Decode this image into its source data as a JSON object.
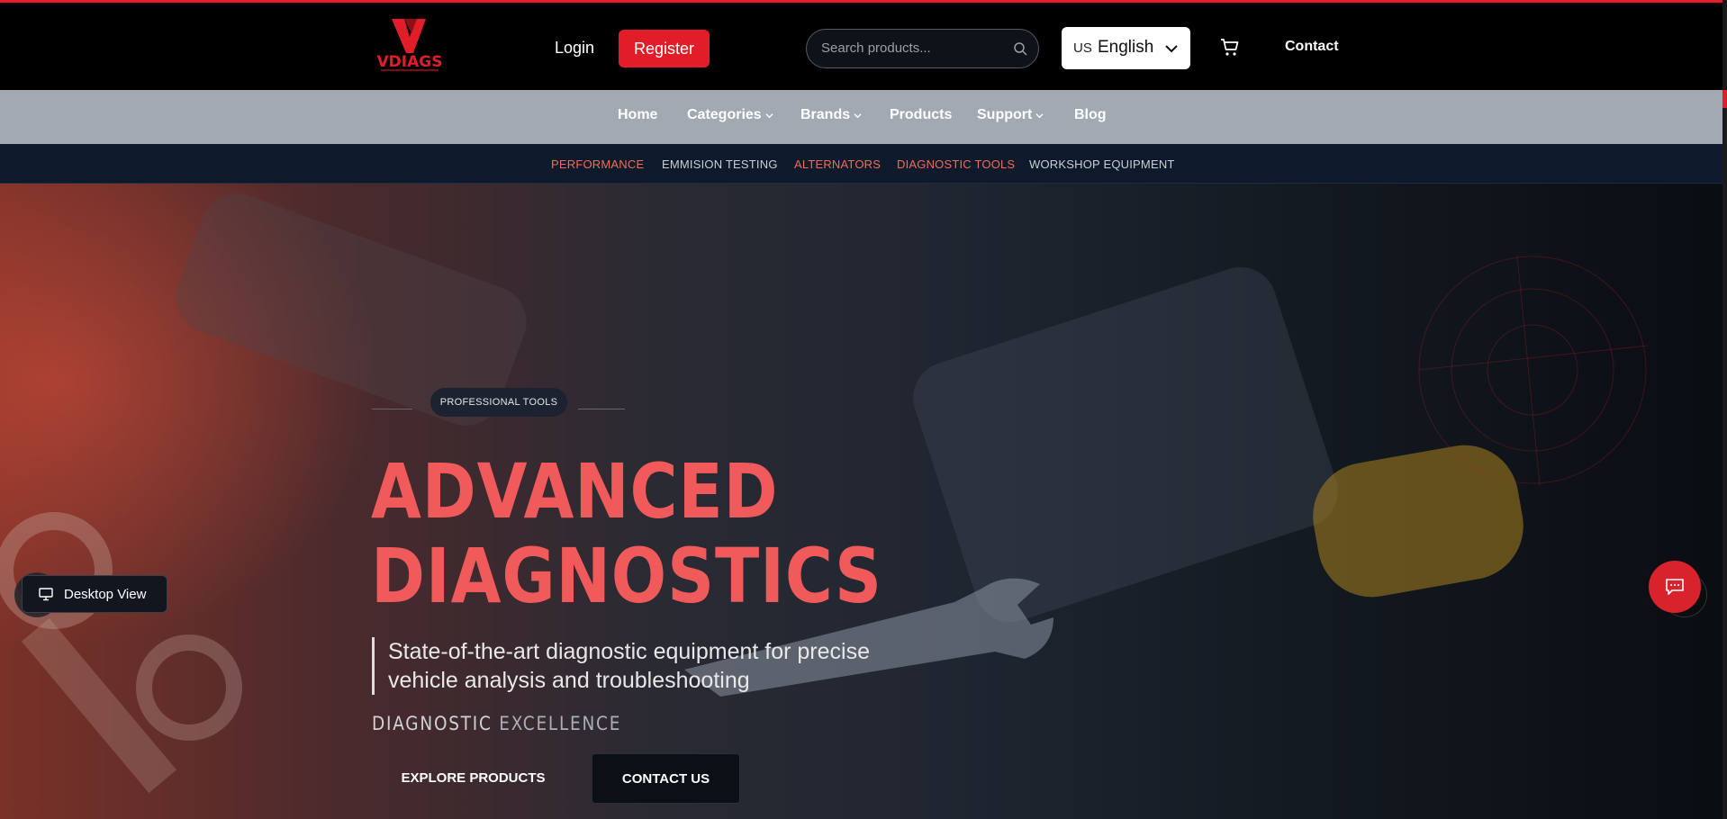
{
  "header": {
    "logo_text": "VDIAGS",
    "login_label": "Login",
    "register_label": "Register",
    "search_placeholder": "Search products...",
    "language": {
      "flag": "US",
      "label": "English"
    },
    "contact_label": "Contact"
  },
  "nav": {
    "items": [
      {
        "label": "Home",
        "dropdown": false
      },
      {
        "label": "Categories",
        "dropdown": true
      },
      {
        "label": "Brands",
        "dropdown": true
      },
      {
        "label": "Products",
        "dropdown": false
      },
      {
        "label": "Support",
        "dropdown": true
      },
      {
        "label": "Blog",
        "dropdown": false
      }
    ]
  },
  "categories": [
    {
      "label": "PERFORMANCE",
      "color": "#f26b5b"
    },
    {
      "label": "EMMISION TESTING",
      "color": "#c9ced6"
    },
    {
      "label": "ALTERNATORS",
      "color": "#f26b5b"
    },
    {
      "label": "DIAGNOSTIC TOOLS",
      "color": "#f26b5b"
    },
    {
      "label": "WORKSHOP EQUIPMENT",
      "color": "#c9ced6"
    }
  ],
  "hero": {
    "badge": "PROFESSIONAL TOOLS",
    "headline_line1": "ADVANCED",
    "headline_line2": "DIAGNOSTICS",
    "subtitle": "State-of-the-art diagnostic equipment for precise vehicle analysis and troubleshooting",
    "tagline_main": "DIAGNOSTIC ",
    "tagline_dim": "EXCELLENCE",
    "explore_button": "EXPLORE PRODUCTS",
    "contact_button": "CONTACT US"
  },
  "footer_widgets": {
    "desktop_view_label": "Desktop View"
  },
  "colors": {
    "brand_red": "#e11d2a",
    "headline": "#f05a5a",
    "nav_bg": "#a2a9b2",
    "category_bg": "#0d1a2b"
  }
}
